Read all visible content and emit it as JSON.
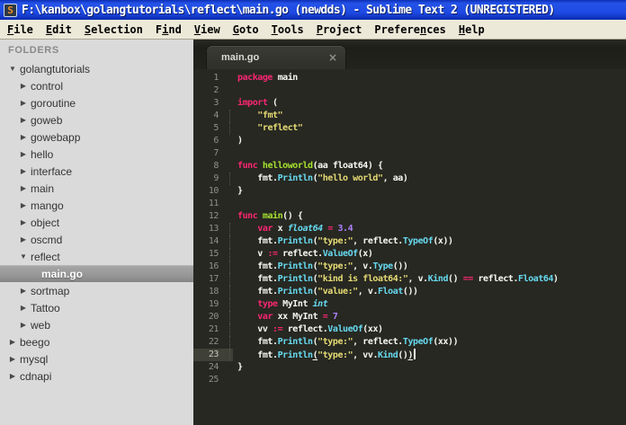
{
  "window": {
    "title": "F:\\kanbox\\golangtutorials\\reflect\\main.go (newdds) - Sublime Text 2 (UNREGISTERED)",
    "app_icon_letter": "S"
  },
  "menu": {
    "items": [
      {
        "label": "File",
        "underline_index": 0
      },
      {
        "label": "Edit",
        "underline_index": 0
      },
      {
        "label": "Selection",
        "underline_index": 0
      },
      {
        "label": "Find",
        "underline_index": 1
      },
      {
        "label": "View",
        "underline_index": 0
      },
      {
        "label": "Goto",
        "underline_index": 0
      },
      {
        "label": "Tools",
        "underline_index": 0
      },
      {
        "label": "Project",
        "underline_index": 0
      },
      {
        "label": "Preferences",
        "underline_index": 7
      },
      {
        "label": "Help",
        "underline_index": 0
      }
    ]
  },
  "sidebar": {
    "header": "FOLDERS",
    "items": [
      {
        "label": "golangtutorials",
        "level": 0,
        "state": "expanded"
      },
      {
        "label": "control",
        "level": 1,
        "state": "collapsed"
      },
      {
        "label": "goroutine",
        "level": 1,
        "state": "collapsed"
      },
      {
        "label": "goweb",
        "level": 1,
        "state": "collapsed"
      },
      {
        "label": "gowebapp",
        "level": 1,
        "state": "collapsed"
      },
      {
        "label": "hello",
        "level": 1,
        "state": "collapsed"
      },
      {
        "label": "interface",
        "level": 1,
        "state": "collapsed"
      },
      {
        "label": "main",
        "level": 1,
        "state": "collapsed"
      },
      {
        "label": "mango",
        "level": 1,
        "state": "collapsed"
      },
      {
        "label": "object",
        "level": 1,
        "state": "collapsed"
      },
      {
        "label": "oscmd",
        "level": 1,
        "state": "collapsed"
      },
      {
        "label": "reflect",
        "level": 1,
        "state": "expanded"
      },
      {
        "label": "main.go",
        "level": 2,
        "state": "file",
        "selected": true
      },
      {
        "label": "sortmap",
        "level": 1,
        "state": "collapsed"
      },
      {
        "label": "Tattoo",
        "level": 1,
        "state": "collapsed"
      },
      {
        "label": "web",
        "level": 1,
        "state": "collapsed"
      },
      {
        "label": "beego",
        "level": 0,
        "state": "collapsed"
      },
      {
        "label": "mysql",
        "level": 0,
        "state": "collapsed"
      },
      {
        "label": "cdnapi",
        "level": 0,
        "state": "collapsed"
      }
    ],
    "expanded_arrow": "▼",
    "collapsed_arrow": "▶"
  },
  "editor": {
    "tab": {
      "label": "main.go",
      "close_glyph": "×"
    },
    "colors": {
      "background": "#272822",
      "gutter_foreground": "#8f908a",
      "current_line_gutter": "#3f4037",
      "caret": "#f8f8f0",
      "k": "#f92672",
      "f": "#a6e22e",
      "s": "#e6db74",
      "n": "#ae81ff",
      "t": "#66d9ef",
      "m": "#66d9ef",
      "w": "#f8f8f2"
    },
    "lines": [
      {
        "n": 1,
        "seg": [
          [
            "k",
            "package"
          ],
          [
            "w",
            " main"
          ]
        ]
      },
      {
        "n": 2,
        "seg": []
      },
      {
        "n": 3,
        "seg": [
          [
            "k",
            "import"
          ],
          [
            "w",
            " ("
          ]
        ]
      },
      {
        "n": 4,
        "guide": true,
        "seg": [
          [
            "w",
            "    "
          ],
          [
            "s",
            "\"fmt\""
          ]
        ]
      },
      {
        "n": 5,
        "guide": true,
        "seg": [
          [
            "w",
            "    "
          ],
          [
            "s",
            "\"reflect\""
          ]
        ]
      },
      {
        "n": 6,
        "seg": [
          [
            "w",
            ")"
          ]
        ]
      },
      {
        "n": 7,
        "seg": []
      },
      {
        "n": 8,
        "seg": [
          [
            "k",
            "func"
          ],
          [
            "w",
            " "
          ],
          [
            "f",
            "helloworld"
          ],
          [
            "w",
            "(aa float64) {"
          ]
        ]
      },
      {
        "n": 9,
        "guide": true,
        "seg": [
          [
            "w",
            "    fmt."
          ],
          [
            "m",
            "Println"
          ],
          [
            "w",
            "("
          ],
          [
            "s",
            "\"hello world\""
          ],
          [
            "w",
            ", aa)"
          ]
        ]
      },
      {
        "n": 10,
        "seg": [
          [
            "w",
            "}"
          ]
        ]
      },
      {
        "n": 11,
        "seg": []
      },
      {
        "n": 12,
        "seg": [
          [
            "k",
            "func"
          ],
          [
            "w",
            " "
          ],
          [
            "f",
            "main"
          ],
          [
            "w",
            "() {"
          ]
        ]
      },
      {
        "n": 13,
        "guide": true,
        "seg": [
          [
            "w",
            "    "
          ],
          [
            "k",
            "var"
          ],
          [
            "w",
            " x "
          ],
          [
            "t",
            "float64"
          ],
          [
            "w",
            " "
          ],
          [
            "k",
            "="
          ],
          [
            "w",
            " "
          ],
          [
            "n",
            "3.4"
          ]
        ]
      },
      {
        "n": 14,
        "guide": true,
        "seg": [
          [
            "w",
            "    fmt."
          ],
          [
            "m",
            "Println"
          ],
          [
            "w",
            "("
          ],
          [
            "s",
            "\"type:\""
          ],
          [
            "w",
            ", reflect."
          ],
          [
            "m",
            "TypeOf"
          ],
          [
            "w",
            "(x))"
          ]
        ]
      },
      {
        "n": 15,
        "guide": true,
        "seg": [
          [
            "w",
            "    v "
          ],
          [
            "k",
            ":="
          ],
          [
            "w",
            " reflect."
          ],
          [
            "m",
            "ValueOf"
          ],
          [
            "w",
            "(x)"
          ]
        ]
      },
      {
        "n": 16,
        "guide": true,
        "seg": [
          [
            "w",
            "    fmt."
          ],
          [
            "m",
            "Println"
          ],
          [
            "w",
            "("
          ],
          [
            "s",
            "\"type:\""
          ],
          [
            "w",
            ", v."
          ],
          [
            "m",
            "Type"
          ],
          [
            "w",
            "())"
          ]
        ]
      },
      {
        "n": 17,
        "guide": true,
        "seg": [
          [
            "w",
            "    fmt."
          ],
          [
            "m",
            "Println"
          ],
          [
            "w",
            "("
          ],
          [
            "s",
            "\"kind is float64:\""
          ],
          [
            "w",
            ", v."
          ],
          [
            "m",
            "Kind"
          ],
          [
            "w",
            "() "
          ],
          [
            "k",
            "=="
          ],
          [
            "w",
            " reflect."
          ],
          [
            "m",
            "Float64"
          ],
          [
            "w",
            ")"
          ]
        ]
      },
      {
        "n": 18,
        "guide": true,
        "seg": [
          [
            "w",
            "    fmt."
          ],
          [
            "m",
            "Println"
          ],
          [
            "w",
            "("
          ],
          [
            "s",
            "\"value:\""
          ],
          [
            "w",
            ", v."
          ],
          [
            "m",
            "Float"
          ],
          [
            "w",
            "())"
          ]
        ]
      },
      {
        "n": 19,
        "guide": true,
        "seg": [
          [
            "w",
            "    "
          ],
          [
            "k",
            "type"
          ],
          [
            "w",
            " MyInt "
          ],
          [
            "t",
            "int"
          ]
        ]
      },
      {
        "n": 20,
        "guide": true,
        "seg": [
          [
            "w",
            "    "
          ],
          [
            "k",
            "var"
          ],
          [
            "w",
            " xx MyInt "
          ],
          [
            "k",
            "="
          ],
          [
            "w",
            " "
          ],
          [
            "n",
            "7"
          ]
        ]
      },
      {
        "n": 21,
        "guide": true,
        "seg": [
          [
            "w",
            "    vv "
          ],
          [
            "k",
            ":="
          ],
          [
            "w",
            " reflect."
          ],
          [
            "m",
            "ValueOf"
          ],
          [
            "w",
            "(xx)"
          ]
        ]
      },
      {
        "n": 22,
        "guide": true,
        "seg": [
          [
            "w",
            "    fmt."
          ],
          [
            "m",
            "Println"
          ],
          [
            "w",
            "("
          ],
          [
            "s",
            "\"type:\""
          ],
          [
            "w",
            ", reflect."
          ],
          [
            "m",
            "TypeOf"
          ],
          [
            "w",
            "(xx))"
          ]
        ]
      },
      {
        "n": 23,
        "guide": true,
        "current": true,
        "caret": true,
        "seg": [
          [
            "w",
            "    fmt."
          ],
          [
            "m",
            "Println"
          ],
          [
            "w",
            "(",
            1
          ],
          [
            "s",
            "\"type:\""
          ],
          [
            "w",
            ", vv."
          ],
          [
            "m",
            "Kind"
          ],
          [
            "w",
            "()"
          ],
          [
            "w",
            ")",
            1
          ]
        ]
      },
      {
        "n": 24,
        "seg": [
          [
            "w",
            "}"
          ]
        ]
      },
      {
        "n": 25,
        "seg": []
      }
    ]
  }
}
